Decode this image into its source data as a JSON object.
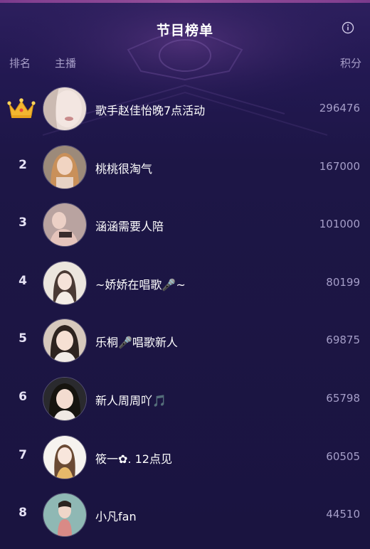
{
  "header": {
    "title": "节目榜单",
    "info_icon": "info-circle-icon"
  },
  "columns": {
    "rank": "排名",
    "host": "主播",
    "score": "积分"
  },
  "colors": {
    "background": "#1c1542",
    "accent": "#a89fc9",
    "crown": "#f2b630"
  },
  "rows": [
    {
      "rank": "",
      "badge": "crown-icon",
      "name": "歌手赵佳怡晚7点活动",
      "score": "296476"
    },
    {
      "rank": "2",
      "name": "桃桃很淘气",
      "score": "167000"
    },
    {
      "rank": "3",
      "name": "涵涵需要人陪",
      "score": "101000"
    },
    {
      "rank": "4",
      "name": "~娇娇在唱歌🎤~",
      "score": "80199"
    },
    {
      "rank": "5",
      "name": "乐桐🎤唱歌新人",
      "score": "69875"
    },
    {
      "rank": "6",
      "name": "新人周周吖🎵",
      "score": "65798"
    },
    {
      "rank": "7",
      "name": "筱一✿. 12点见",
      "score": "60505"
    },
    {
      "rank": "8",
      "name": "小凡fan",
      "score": "44510"
    }
  ]
}
